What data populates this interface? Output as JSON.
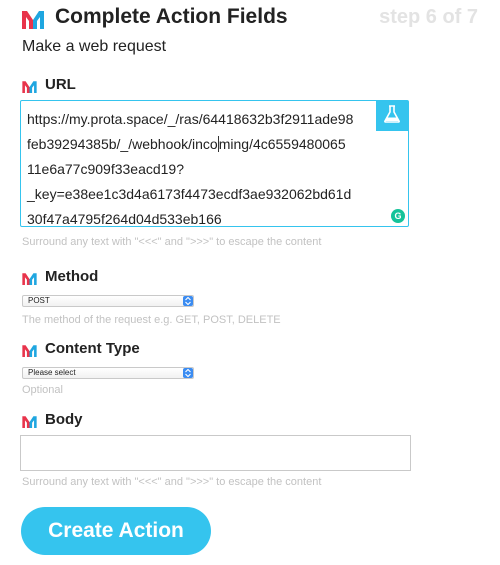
{
  "header": {
    "title": "Complete Action Fields",
    "step": "step 6 of 7",
    "icon": "maker-logo-icon"
  },
  "subtitle": "Make a web request",
  "url_field": {
    "label": "URL",
    "value_lines": [
      "https://my.prota.space/_/ras/64418632b3f2911ade98",
      "feb39294385b/_/webhook/incoming/4c6559480065",
      "11e6a77c909f33eacd19?",
      "_key=e38ee1c3d4a6173f4473ecdf3ae932062bd61d",
      "30f47a4795f264d04d533eb166"
    ],
    "caret_line_parts": [
      "feb39294385b/_/webhook/inco",
      "ming/4c6559480065"
    ],
    "help": "Surround any text with \"<<<\" and \">>>\" to escape the content",
    "ingredients_icon": "flask-icon",
    "grammarly_letter": "G"
  },
  "method_field": {
    "label": "Method",
    "selected": "POST",
    "help": "The method of the request e.g. GET, POST, DELETE"
  },
  "content_type_field": {
    "label": "Content Type",
    "selected": "Please select",
    "help": "Optional"
  },
  "body_field": {
    "label": "Body",
    "value": "",
    "help": "Surround any text with \"<<<\" and \">>>\" to escape the content"
  },
  "create_button": {
    "label": "Create Action"
  },
  "colors": {
    "accent": "#35c4ee",
    "logo_red": "#e8344b",
    "logo_blue": "#1fa6e0",
    "step_gray": "#e3e3e3",
    "help_gray": "#c2c2c2"
  }
}
